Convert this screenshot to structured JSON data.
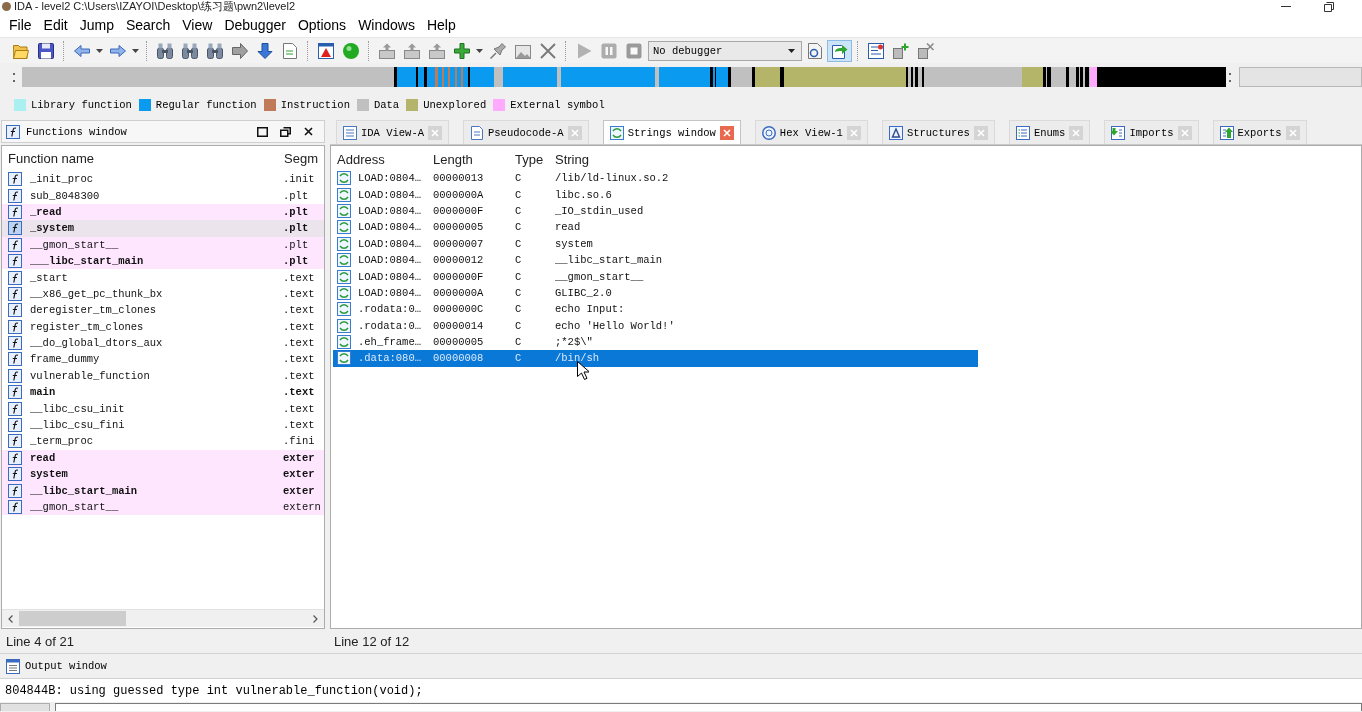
{
  "window": {
    "title": "IDA - level2 C:\\Users\\IZAYOI\\Desktop\\练习题\\pwn2\\level2"
  },
  "menu": [
    "File",
    "Edit",
    "Jump",
    "Search",
    "View",
    "Debugger",
    "Options",
    "Windows",
    "Help"
  ],
  "toolbar": {
    "groups": [
      [
        {
          "kind": "folder",
          "pressed": false,
          "disabled": false
        },
        {
          "kind": "floppy",
          "pressed": false,
          "disabled": false
        }
      ],
      [
        {
          "kind": "back",
          "pressed": false,
          "disabled": false
        },
        {
          "kind": "caret",
          "pressed": false,
          "disabled": false
        },
        {
          "kind": "forward",
          "pressed": false,
          "disabled": false
        },
        {
          "kind": "caret",
          "pressed": false,
          "disabled": false
        }
      ],
      [
        {
          "kind": "binoculars",
          "pressed": false,
          "disabled": false
        },
        {
          "kind": "binoculars",
          "pressed": false,
          "disabled": false
        },
        {
          "kind": "binoculars",
          "pressed": false,
          "disabled": false
        },
        {
          "kind": "jump",
          "pressed": false,
          "disabled": false
        },
        {
          "kind": "down",
          "pressed": false,
          "disabled": false
        },
        {
          "kind": "page",
          "pressed": false,
          "disabled": false
        }
      ],
      [
        {
          "kind": "warning",
          "pressed": false,
          "disabled": false
        },
        {
          "kind": "ball",
          "pressed": false,
          "disabled": false
        }
      ],
      [
        {
          "kind": "boxup",
          "pressed": false,
          "disabled": false
        },
        {
          "kind": "boxup",
          "pressed": false,
          "disabled": false
        },
        {
          "kind": "boxup",
          "pressed": false,
          "disabled": false
        },
        {
          "kind": "plus",
          "pressed": false,
          "disabled": false
        },
        {
          "kind": "caret",
          "pressed": false,
          "disabled": false
        },
        {
          "kind": "pin",
          "pressed": false,
          "disabled": false
        },
        {
          "kind": "image",
          "pressed": false,
          "disabled": false
        },
        {
          "kind": "cross",
          "pressed": false,
          "disabled": false
        }
      ],
      [
        {
          "kind": "play",
          "pressed": false,
          "disabled": true
        },
        {
          "kind": "pause",
          "pressed": false,
          "disabled": true
        },
        {
          "kind": "stop",
          "pressed": false,
          "disabled": true
        },
        {
          "kind": "select",
          "value": "No debugger",
          "pressed": false,
          "disabled": false
        },
        {
          "kind": "circlepage",
          "pressed": false,
          "disabled": false
        },
        {
          "kind": "arrowpage",
          "pressed": true,
          "disabled": false
        }
      ],
      [
        {
          "kind": "list",
          "pressed": false,
          "disabled": false
        },
        {
          "kind": "plustool",
          "pressed": false,
          "disabled": false
        },
        {
          "kind": "remove",
          "pressed": false,
          "disabled": false
        }
      ]
    ]
  },
  "legend": [
    {
      "label": "Library function",
      "color": "#aaf0f0"
    },
    {
      "label": "Regular function",
      "color": "#0a9af0"
    },
    {
      "label": "Instruction",
      "color": "#c07a58"
    },
    {
      "label": "Data",
      "color": "#c0c0c0"
    },
    {
      "label": "Unexplored",
      "color": "#b4b46c"
    },
    {
      "label": "External symbol",
      "color": "#ffaaff"
    }
  ],
  "functions_window": {
    "title": "Functions window",
    "columns": [
      "Function name",
      "Segm"
    ],
    "rows": [
      {
        "name": "_init_proc",
        "segment": ".init",
        "emphasized": false,
        "external": false,
        "selected": false
      },
      {
        "name": "sub_8048300",
        "segment": ".plt",
        "emphasized": false,
        "external": false,
        "selected": false
      },
      {
        "name": "_read",
        "segment": ".plt",
        "emphasized": true,
        "external": true,
        "selected": false
      },
      {
        "name": "_system",
        "segment": ".plt",
        "emphasized": true,
        "external": true,
        "selected": true
      },
      {
        "name": "__gmon_start__",
        "segment": ".plt",
        "emphasized": false,
        "external": true,
        "selected": false
      },
      {
        "name": "___libc_start_main",
        "segment": ".plt",
        "emphasized": true,
        "external": true,
        "selected": false
      },
      {
        "name": "_start",
        "segment": ".text",
        "emphasized": false,
        "external": false,
        "selected": false
      },
      {
        "name": "__x86_get_pc_thunk_bx",
        "segment": ".text",
        "emphasized": false,
        "external": false,
        "selected": false
      },
      {
        "name": "deregister_tm_clones",
        "segment": ".text",
        "emphasized": false,
        "external": false,
        "selected": false
      },
      {
        "name": "register_tm_clones",
        "segment": ".text",
        "emphasized": false,
        "external": false,
        "selected": false
      },
      {
        "name": "__do_global_dtors_aux",
        "segment": ".text",
        "emphasized": false,
        "external": false,
        "selected": false
      },
      {
        "name": "frame_dummy",
        "segment": ".text",
        "emphasized": false,
        "external": false,
        "selected": false
      },
      {
        "name": "vulnerable_function",
        "segment": ".text",
        "emphasized": false,
        "external": false,
        "selected": false
      },
      {
        "name": "main",
        "segment": ".text",
        "emphasized": true,
        "external": false,
        "selected": false
      },
      {
        "name": "__libc_csu_init",
        "segment": ".text",
        "emphasized": false,
        "external": false,
        "selected": false
      },
      {
        "name": "__libc_csu_fini",
        "segment": ".text",
        "emphasized": false,
        "external": false,
        "selected": false
      },
      {
        "name": "_term_proc",
        "segment": ".fini",
        "emphasized": false,
        "external": false,
        "selected": false
      },
      {
        "name": "read",
        "segment": "exter",
        "emphasized": true,
        "external": true,
        "selected": false
      },
      {
        "name": "system",
        "segment": "exter",
        "emphasized": true,
        "external": true,
        "selected": false
      },
      {
        "name": "__libc_start_main",
        "segment": "exter",
        "emphasized": true,
        "external": true,
        "selected": false
      },
      {
        "name": "__gmon_start__",
        "segment": "extern",
        "emphasized": false,
        "external": true,
        "selected": false
      }
    ]
  },
  "tabs": [
    {
      "label": "IDA View-A",
      "kind": "lines",
      "selected": false
    },
    {
      "label": "Pseudocode-A",
      "kind": "page",
      "selected": false
    },
    {
      "label": "Strings window",
      "kind": "wave",
      "selected": true
    },
    {
      "label": "Hex View-1",
      "kind": "ring",
      "selected": false
    },
    {
      "label": "Structures",
      "kind": "frame",
      "selected": false
    },
    {
      "label": "Enums",
      "kind": "list",
      "selected": false
    },
    {
      "label": "Imports",
      "kind": "inbox",
      "selected": false
    },
    {
      "label": "Exports",
      "kind": "outbox",
      "selected": false
    }
  ],
  "strings_window": {
    "columns": [
      "Address",
      "Length",
      "Type",
      "String"
    ],
    "rows": [
      {
        "address": "LOAD:0804…",
        "length": "00000013",
        "type": "C",
        "string": "/lib/ld-linux.so.2",
        "selected": false
      },
      {
        "address": "LOAD:0804…",
        "length": "0000000A",
        "type": "C",
        "string": "libc.so.6",
        "selected": false
      },
      {
        "address": "LOAD:0804…",
        "length": "0000000F",
        "type": "C",
        "string": "_IO_stdin_used",
        "selected": false
      },
      {
        "address": "LOAD:0804…",
        "length": "00000005",
        "type": "C",
        "string": "read",
        "selected": false
      },
      {
        "address": "LOAD:0804…",
        "length": "00000007",
        "type": "C",
        "string": "system",
        "selected": false
      },
      {
        "address": "LOAD:0804…",
        "length": "00000012",
        "type": "C",
        "string": "__libc_start_main",
        "selected": false
      },
      {
        "address": "LOAD:0804…",
        "length": "0000000F",
        "type": "C",
        "string": "__gmon_start__",
        "selected": false
      },
      {
        "address": "LOAD:0804…",
        "length": "0000000A",
        "type": "C",
        "string": "GLIBC_2.0",
        "selected": false
      },
      {
        "address": ".rodata:0…",
        "length": "0000000C",
        "type": "C",
        "string": "echo Input:",
        "selected": false
      },
      {
        "address": ".rodata:0…",
        "length": "00000014",
        "type": "C",
        "string": "echo 'Hello World!'",
        "selected": false
      },
      {
        "address": ".eh_frame…",
        "length": "00000005",
        "type": "C",
        "string": ";*2$\\\"",
        "selected": false
      },
      {
        "address": ".data:080…",
        "length": "00000008",
        "type": "C",
        "string": "/bin/sh",
        "selected": true
      }
    ]
  },
  "status": {
    "functions": "Line 4 of 21",
    "strings": "Line 12 of 12"
  },
  "output_window": {
    "title": "Output window",
    "text": "804844B: using guessed type int vulnerable_function(void);"
  }
}
